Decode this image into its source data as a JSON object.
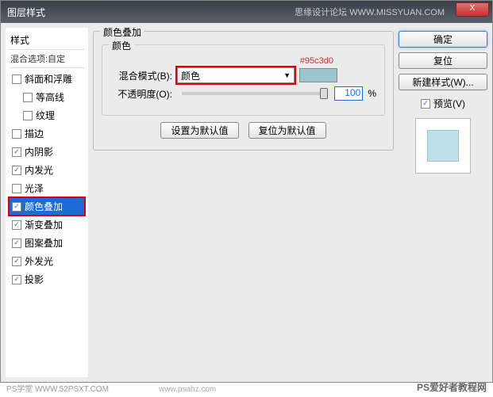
{
  "title": "图层样式",
  "watermark_top": "思缘设计论坛  WWW.MISSYUAN.COM",
  "close": "X",
  "left": {
    "header": "样式",
    "blend_label": "混合选项:自定",
    "items": [
      {
        "label": "斜面和浮雕",
        "checked": false,
        "sub": false
      },
      {
        "label": "等高线",
        "checked": false,
        "sub": true
      },
      {
        "label": "纹理",
        "checked": false,
        "sub": true
      },
      {
        "label": "描边",
        "checked": false,
        "sub": false
      },
      {
        "label": "内阴影",
        "checked": true,
        "sub": false
      },
      {
        "label": "内发光",
        "checked": true,
        "sub": false
      },
      {
        "label": "光泽",
        "checked": false,
        "sub": false
      },
      {
        "label": "颜色叠加",
        "checked": true,
        "sub": false,
        "selected": true
      },
      {
        "label": "渐变叠加",
        "checked": true,
        "sub": false
      },
      {
        "label": "图案叠加",
        "checked": true,
        "sub": false
      },
      {
        "label": "外发光",
        "checked": true,
        "sub": false
      },
      {
        "label": "投影",
        "checked": true,
        "sub": false
      }
    ]
  },
  "mid": {
    "group_title": "颜色叠加",
    "inner_title": "颜色",
    "hex": "#95c3d0",
    "blend_label": "混合模式(B):",
    "blend_value": "颜色",
    "opacity_label": "不透明度(O):",
    "opacity_value": "100",
    "opacity_pct": "%",
    "default_btn": "设置为默认值",
    "reset_btn": "复位为默认值"
  },
  "right": {
    "ok": "确定",
    "cancel": "复位",
    "new_style": "新建样式(W)...",
    "preview_label": "预览(V)"
  },
  "footer": {
    "left": "PS学堂  WWW.52PSXT.COM",
    "mid": "www.psahz.com",
    "right": "PS爱好者教程网"
  }
}
